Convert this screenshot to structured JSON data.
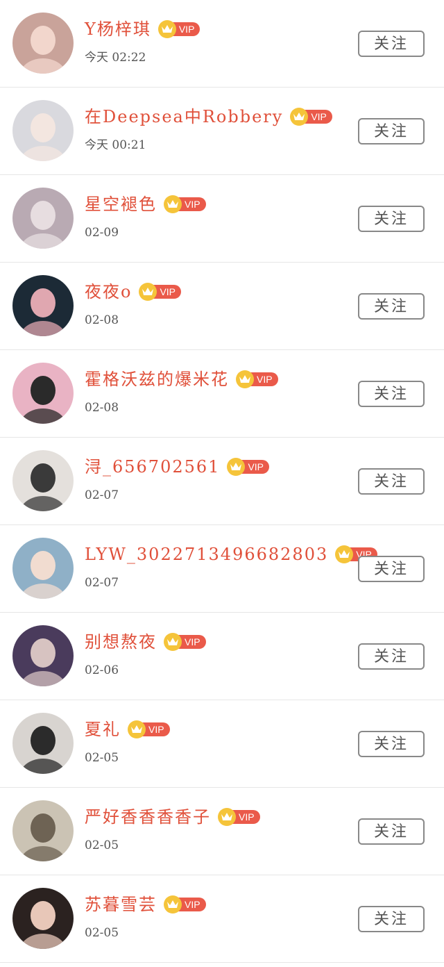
{
  "vip_label": "VIP",
  "follow_label": "关注",
  "colors": {
    "name": "#e0503a",
    "vip_badge": "#ea5a4a",
    "crown": "#f5c43a",
    "divider": "#e6e6e6"
  },
  "users": [
    {
      "name": "Y杨梓琪",
      "time": "今天 02:22",
      "avatar_bg": "#c9a39a",
      "avatar_fg": "#f2d6cc"
    },
    {
      "name": "在Deepsea中Robbery",
      "time": "今天 00:21",
      "avatar_bg": "#d9d9de",
      "avatar_fg": "#f3e6e0"
    },
    {
      "name": "星空褪色",
      "time": "02-09",
      "avatar_bg": "#b9aab3",
      "avatar_fg": "#e7dde0"
    },
    {
      "name": "夜夜o",
      "time": "02-08",
      "avatar_bg": "#1c2a36",
      "avatar_fg": "#e0a7b0"
    },
    {
      "name": "霍格沃兹的爆米花",
      "time": "02-08",
      "avatar_bg": "#e9b3c4",
      "avatar_fg": "#2a2a2a"
    },
    {
      "name": "浔_656702561",
      "time": "02-07",
      "avatar_bg": "#e4e0dc",
      "avatar_fg": "#3a3a3a"
    },
    {
      "name": "LYW_3022713496682803",
      "time": "02-07",
      "avatar_bg": "#8fb0c7",
      "avatar_fg": "#f1dcd0"
    },
    {
      "name": "别想熬夜",
      "time": "02-06",
      "avatar_bg": "#4a3b5c",
      "avatar_fg": "#d7c3c1"
    },
    {
      "name": "夏礼",
      "time": "02-05",
      "avatar_bg": "#d8d4d0",
      "avatar_fg": "#2b2b2b"
    },
    {
      "name": "严好香香香香子",
      "time": "02-05",
      "avatar_bg": "#cbc3b4",
      "avatar_fg": "#6e6354"
    },
    {
      "name": "苏暮雪芸",
      "time": "02-05",
      "avatar_bg": "#2b2220",
      "avatar_fg": "#e8c7b8"
    }
  ]
}
